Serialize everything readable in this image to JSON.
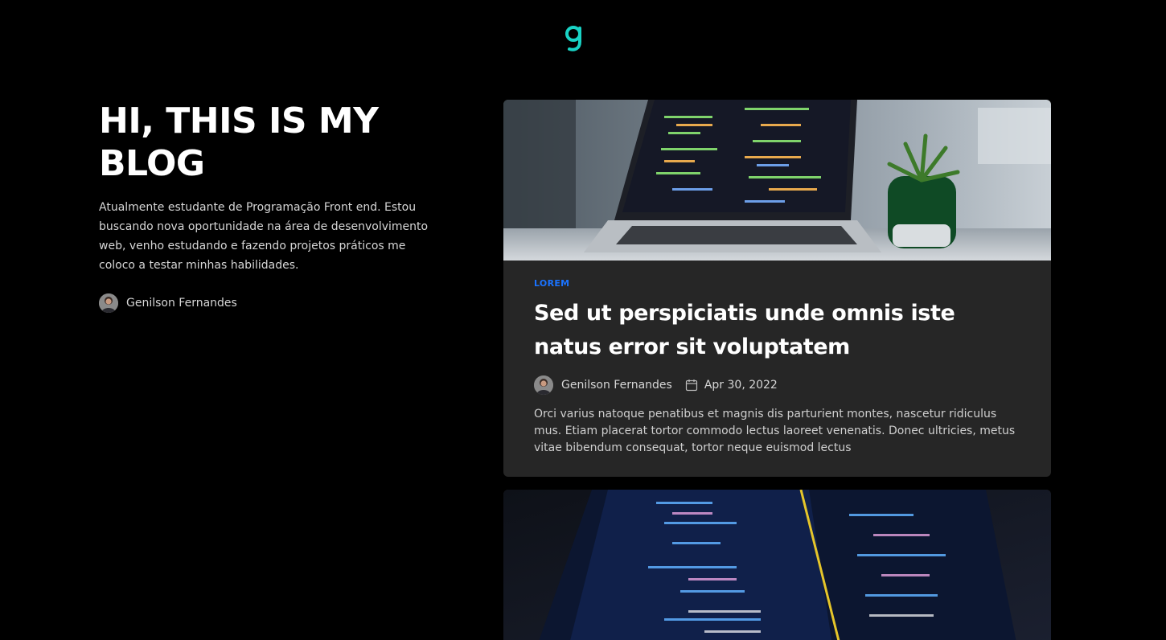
{
  "brand": {
    "logo_icon": "g-logo-icon",
    "accent_color": "#19d3c5"
  },
  "intro": {
    "title": "HI, THIS IS MY BLOG",
    "description": "Atualmente estudante de Programação Front end. Estou buscando nova oportunidade na área de desenvolvimento web, venho estudando e fazendo projetos práticos me coloco a testar minhas habilidades.",
    "author": "Genilson Fernandes"
  },
  "posts": [
    {
      "category": "LOREM",
      "title": "Sed ut perspiciatis unde omnis iste natus error sit voluptatem",
      "author": "Genilson Fernandes",
      "date": "Apr 30, 2022",
      "excerpt": "Orci varius natoque penatibus et magnis dis parturient montes, nascetur ridiculus mus. Etiam placerat tortor commodo lectus laoreet venenatis. Donec ultricies, metus vitae bibendum consequat, tortor neque euismod lectus",
      "cover": "laptop-code-photo"
    },
    {
      "cover": "code-screen-photo"
    }
  ],
  "colors": {
    "background": "#000000",
    "card": "#262626",
    "category": "#1a73ff"
  }
}
